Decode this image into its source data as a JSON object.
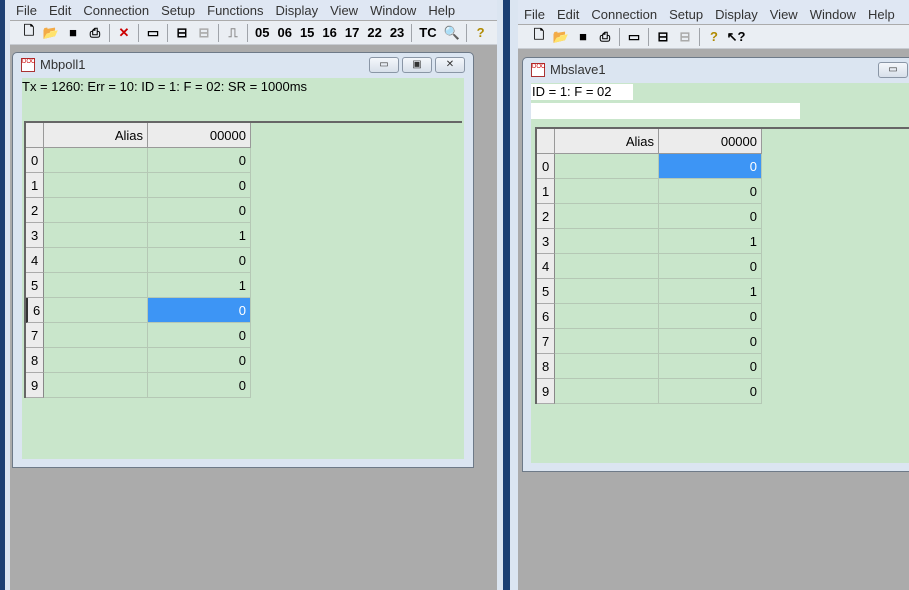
{
  "left_app": {
    "menu": [
      "File",
      "Edit",
      "Connection",
      "Setup",
      "Functions",
      "Display",
      "View",
      "Window",
      "Help"
    ],
    "toolbar": {
      "icons": [
        "new-icon",
        "open-icon",
        "save-icon",
        "print-icon",
        "delete-icon",
        "window-icon",
        "connect-icon",
        "disconnect-icon",
        "pulse-icon"
      ],
      "function_codes": [
        "05",
        "06",
        "15",
        "16",
        "17",
        "22",
        "23"
      ],
      "tc": "TC",
      "extra_icons": [
        "monitor-icon",
        "help-icon"
      ]
    },
    "window": {
      "title": "Mbpoll1",
      "status": "Tx = 1260: Err = 10: ID = 1: F = 02: SR = 1000ms",
      "grid": {
        "headers": [
          "Alias",
          "00000"
        ],
        "rows": [
          {
            "index": "0",
            "value": "0"
          },
          {
            "index": "1",
            "value": "0"
          },
          {
            "index": "2",
            "value": "0"
          },
          {
            "index": "3",
            "value": "1"
          },
          {
            "index": "4",
            "value": "0"
          },
          {
            "index": "5",
            "value": "1"
          },
          {
            "index": "6",
            "value": "0"
          },
          {
            "index": "7",
            "value": "0"
          },
          {
            "index": "8",
            "value": "0"
          },
          {
            "index": "9",
            "value": "0"
          }
        ],
        "selected_row": 6
      }
    }
  },
  "right_app": {
    "menu": [
      "File",
      "Edit",
      "Connection",
      "Setup",
      "Display",
      "View",
      "Window",
      "Help"
    ],
    "window": {
      "title": "Mbslave1",
      "status": "ID = 1: F = 02",
      "grid": {
        "headers": [
          "Alias",
          "00000"
        ],
        "rows": [
          {
            "index": "0",
            "value": "0"
          },
          {
            "index": "1",
            "value": "0"
          },
          {
            "index": "2",
            "value": "0"
          },
          {
            "index": "3",
            "value": "1"
          },
          {
            "index": "4",
            "value": "0"
          },
          {
            "index": "5",
            "value": "1"
          },
          {
            "index": "6",
            "value": "0"
          },
          {
            "index": "7",
            "value": "0"
          },
          {
            "index": "8",
            "value": "0"
          },
          {
            "index": "9",
            "value": "0"
          }
        ],
        "selected_row": 0
      }
    }
  },
  "colors": {
    "client_bg": "#c9e6cb",
    "selection": "#3d95f5",
    "mdi_bg": "#ababab"
  }
}
